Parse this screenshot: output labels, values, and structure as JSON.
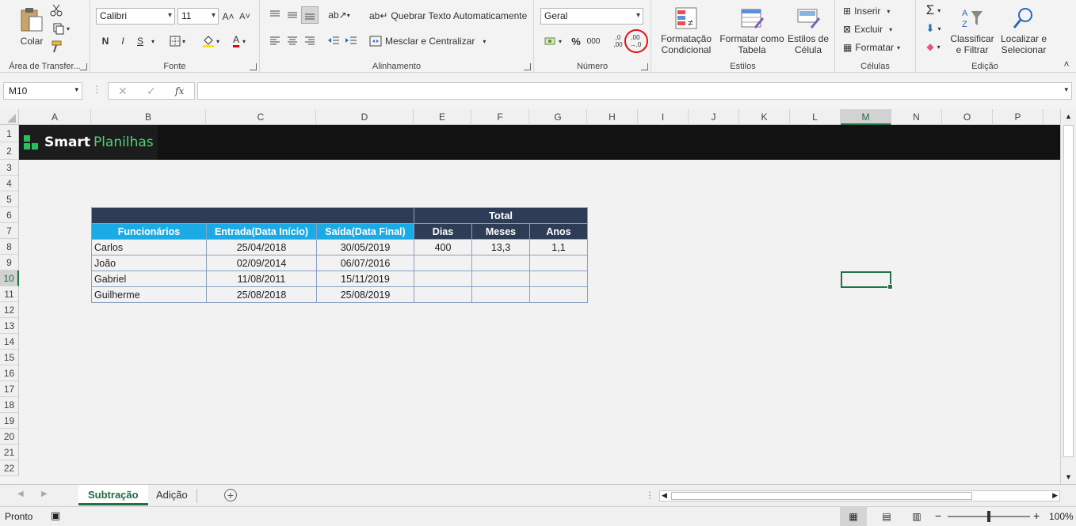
{
  "ribbon": {
    "clipboard": {
      "paste_label": "Colar",
      "group_label": "Área de Transfer..."
    },
    "font": {
      "font_name": "Calibri",
      "font_size": "11",
      "bold": "N",
      "italic": "I",
      "underline": "S",
      "color_letter": "A",
      "group_label": "Fonte"
    },
    "alignment": {
      "wrap_label": "Quebrar Texto Automaticamente",
      "merge_label": "Mesclar e Centralizar",
      "group_label": "Alinhamento"
    },
    "number": {
      "format": "Geral",
      "percent": "%",
      "thousands": "000",
      "inc_decimal_top": ",0",
      "inc_decimal_bottom": ",00",
      "dec_decimal_top": ",00",
      "dec_decimal_bottom": "→,0",
      "group_label": "Número"
    },
    "styles": {
      "cond_format_line1": "Formatação",
      "cond_format_line2": "Condicional",
      "table_line1": "Formatar como",
      "table_line2": "Tabela",
      "cell_styles_line1": "Estilos de",
      "cell_styles_line2": "Célula",
      "group_label": "Estilos"
    },
    "cells": {
      "insert": "Inserir",
      "delete": "Excluir",
      "format": "Formatar",
      "group_label": "Células"
    },
    "editing": {
      "sort_line1": "Classificar",
      "sort_line2": "e Filtrar",
      "find_line1": "Localizar e",
      "find_line2": "Selecionar",
      "group_label": "Edição"
    }
  },
  "formula_bar": {
    "name_box": "M10",
    "fx": "fx",
    "formula": ""
  },
  "columns": [
    "A",
    "B",
    "C",
    "D",
    "E",
    "F",
    "G",
    "H",
    "I",
    "J",
    "K",
    "L",
    "M",
    "N",
    "O",
    "P"
  ],
  "rows": [
    "1",
    "2",
    "3",
    "4",
    "5",
    "6",
    "7",
    "8",
    "9",
    "10",
    "11",
    "12",
    "13",
    "14",
    "15",
    "16",
    "17",
    "18",
    "19",
    "20",
    "21",
    "22"
  ],
  "banner": {
    "brand_bold": "Smart",
    "brand_light": "Planilhas"
  },
  "table": {
    "total_label": "Total",
    "headers": [
      "Funcionários",
      "Entrada(Data Início)",
      "Saída(Data Final)",
      "Dias",
      "Meses",
      "Anos"
    ],
    "rows": [
      [
        "Carlos",
        "25/04/2018",
        "30/05/2019",
        "400",
        "13,3",
        "1,1"
      ],
      [
        "João",
        "02/09/2014",
        "06/07/2016",
        "",
        "",
        ""
      ],
      [
        "Gabriel",
        "11/08/2011",
        "15/11/2019",
        "",
        "",
        ""
      ],
      [
        "Guilherme",
        "25/08/2018",
        "25/08/2019",
        "",
        "",
        ""
      ]
    ]
  },
  "sheets": {
    "tabs": [
      "Subtração",
      "Adição"
    ],
    "active": "Subtração"
  },
  "status": {
    "ready": "Pronto",
    "zoom": "100%"
  },
  "colors": {
    "accent": "#217346",
    "header_dark": "#2e3d55",
    "header_blue": "#1aabe6"
  }
}
